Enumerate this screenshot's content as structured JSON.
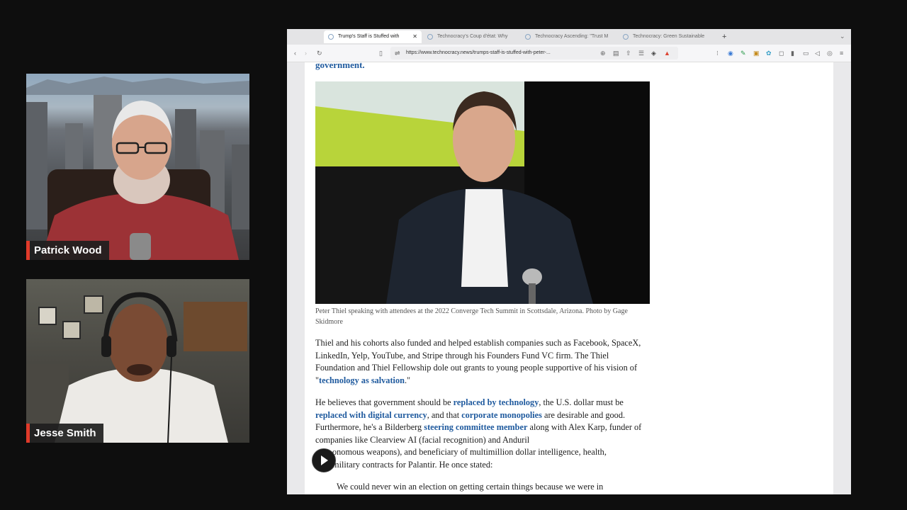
{
  "participants": [
    {
      "name": "Patrick Wood"
    },
    {
      "name": "Jesse Smith"
    }
  ],
  "browser": {
    "tabs": [
      {
        "label": "Trump's Staff is Stuffed with",
        "active": true
      },
      {
        "label": "Technocracy's Coup d'état: Why",
        "active": false
      },
      {
        "label": "Technocracy Ascending: \"Trust M",
        "active": false
      },
      {
        "label": "Technocracy: Green Sustainable",
        "active": false
      }
    ],
    "new_tab": "+",
    "url": "https://www.technocracy.news/trumps-staff-is-stuffed-with-peter-..."
  },
  "article": {
    "top_fragment": "government.",
    "caption": "Peter Thiel speaking with attendees at the 2022 Converge Tech Summit in Scottsdale, Arizona. Photo by Gage Skidmore",
    "p1_a": "Thiel and his cohorts also funded and helped establish companies such as Facebook, SpaceX, LinkedIn, Yelp, YouTube, and Stripe through his Founders Fund VC firm. The Thiel Foundation and Thiel Fellowship dole out grants to young people supportive of his vision of \"",
    "p1_link": "technology as salvation",
    "p1_b": ".\"",
    "p2_a": "He believes that government should be ",
    "p2_link1": "replaced by technology",
    "p2_b": ", the U.S. dollar must be ",
    "p2_link2": "replaced with digital currency",
    "p2_c": ", and that ",
    "p2_link3": "corporate monopolies",
    "p2_d": " are desirable and good. Furthermore, he's a Bilderberg ",
    "p2_link4": "steering committee member",
    "p2_e": " along with Alex Karp, funder of companies like Clearview AI (facial recognition) and Anduril ",
    "p2_f": "onomous weapons), and beneficiary of multimillion dollar intelligence, health, ",
    "p2_g": "military contracts for Palantir. He once stated:",
    "quote": "We could never win an election on getting certain things because we were in"
  },
  "colors": {
    "link": "#1f5a9e",
    "name_accent": "#e03a2a"
  }
}
